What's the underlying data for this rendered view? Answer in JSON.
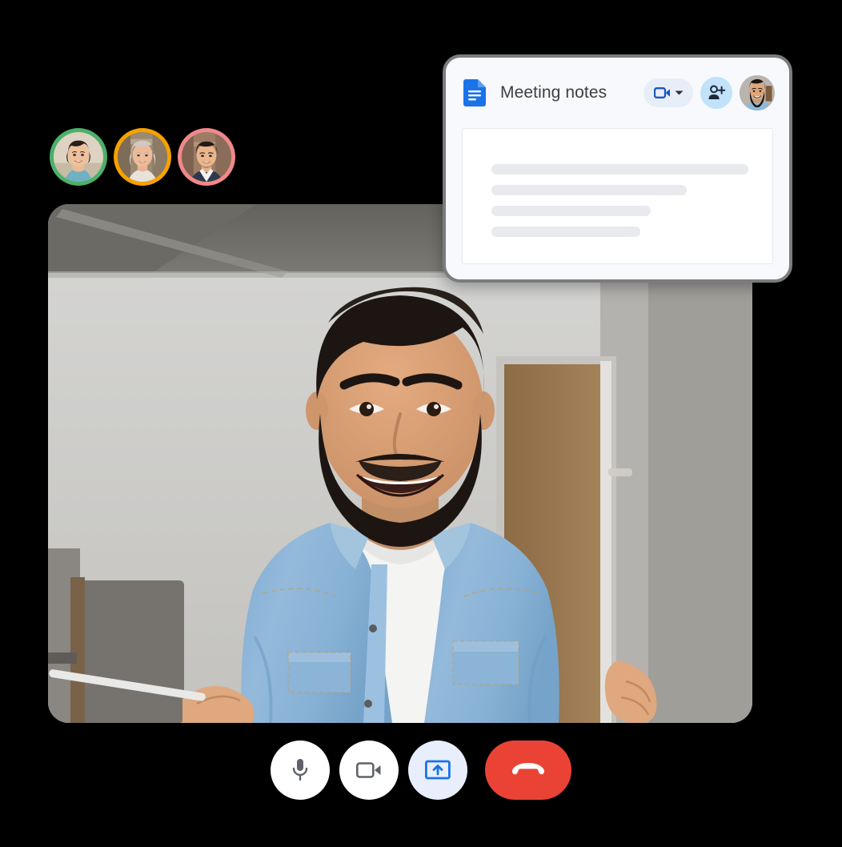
{
  "app": {
    "name": "Google Meet video call with Docs meeting notes",
    "background_color": "#000000"
  },
  "participants": {
    "label": "Meeting participants",
    "items": [
      {
        "name": "participant-1",
        "ring_color": "#4cb06a",
        "bg_color": "#ded3c2",
        "skin": "#e8bb97",
        "hair": "#2b1d17",
        "clothes": "#7fb7c6"
      },
      {
        "name": "participant-2",
        "ring_color": "#f5a100",
        "bg_color": "#9b8a72",
        "skin": "#e7b392",
        "hair": "#cfc9c2",
        "clothes": "#e8e2da"
      },
      {
        "name": "participant-3",
        "ring_color": "#f1888a",
        "bg_color": "#9c7c65",
        "skin": "#e3b089",
        "hair": "#241a15",
        "clothes": "#2d3a4d"
      }
    ]
  },
  "video_tile": {
    "label": "Main speaker video",
    "speaker_name": "",
    "scene": {
      "ceiling_color": "#6e6d68",
      "wall_color": "#cfcfcd",
      "floor_color": "#b9b7b3",
      "door_color": "#9a7b52",
      "denim_color": "#8cb4d6",
      "denim_shadow": "#6f9cc4",
      "shirt_color": "#f2f2f0",
      "skin_color": "#d9a077",
      "hair_color": "#1d1512"
    }
  },
  "notes_card": {
    "title": "Meeting notes",
    "doc_icon": "google-docs-icon",
    "accent_color": "#1a73e8",
    "border_color": "#7b7c80",
    "camera_button": {
      "name": "camera-dropdown-button",
      "icon": "video-camera-icon",
      "dropdown_icon": "chevron-down-icon",
      "bg_color": "#e8eef8",
      "icon_color": "#1a56c4"
    },
    "add_person_button": {
      "name": "add-person-button",
      "icon": "person-add-icon",
      "bg_color": "#c1e2fa",
      "icon_color": "#1f2937"
    },
    "avatar": {
      "name": "user-avatar",
      "alt": "Current user avatar"
    },
    "body_lines": [
      {
        "width_pct": 100
      },
      {
        "width_pct": 76
      },
      {
        "width_pct": 62
      },
      {
        "width_pct": 58
      }
    ],
    "line_color": "#e8eaed"
  },
  "controls": {
    "label": "Call controls",
    "items": [
      {
        "name": "microphone-button",
        "icon": "microphone-icon",
        "style": "white",
        "state": "on",
        "bg_color": "#ffffff",
        "icon_color": "#5f6368"
      },
      {
        "name": "camera-button",
        "icon": "video-camera-icon",
        "style": "white",
        "state": "on",
        "bg_color": "#ffffff",
        "icon_color": "#5f6368"
      },
      {
        "name": "present-screen-button",
        "icon": "present-to-all-icon",
        "style": "present",
        "state": "active",
        "bg_color": "#e8eefb",
        "icon_color": "#1a73e8"
      },
      {
        "name": "hang-up-button",
        "icon": "phone-hangup-icon",
        "style": "danger",
        "state": "idle",
        "bg_color": "#ea4335",
        "icon_color": "#ffffff"
      }
    ]
  }
}
